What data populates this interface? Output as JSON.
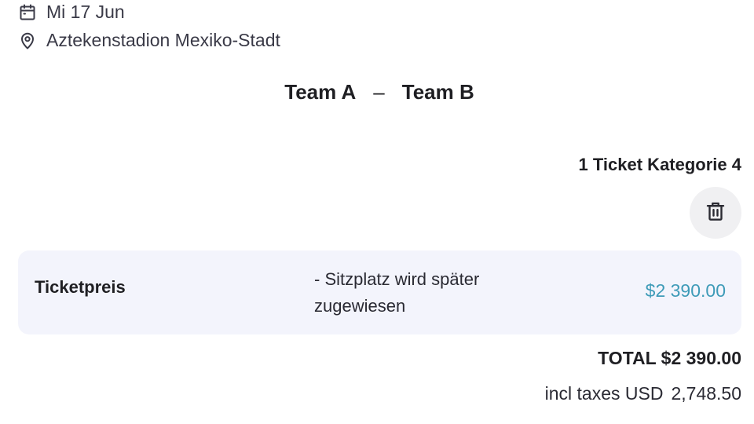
{
  "event": {
    "date": "Mi 17 Jun",
    "venue": "Aztekenstadion Mexiko-Stadt",
    "team_home": "Team A",
    "separator": "–",
    "team_away": "Team B"
  },
  "ticket": {
    "category_label": "1 Ticket Kategorie 4",
    "price_label": "Ticketpreis",
    "price_note": "- Sitzplatz wird später zugewiesen",
    "price_value": "$2 390.00"
  },
  "summary": {
    "total": "TOTAL $2 390.00",
    "taxes_label": "incl taxes USD",
    "taxes_value": "2,748.50"
  },
  "icons": {
    "date": "calendar-icon",
    "venue": "location-pin-icon",
    "delete": "trash-icon"
  },
  "colors": {
    "price_accent": "#3e9bb8",
    "card_background": "#f3f4fc",
    "button_background": "#f0f0f2"
  }
}
